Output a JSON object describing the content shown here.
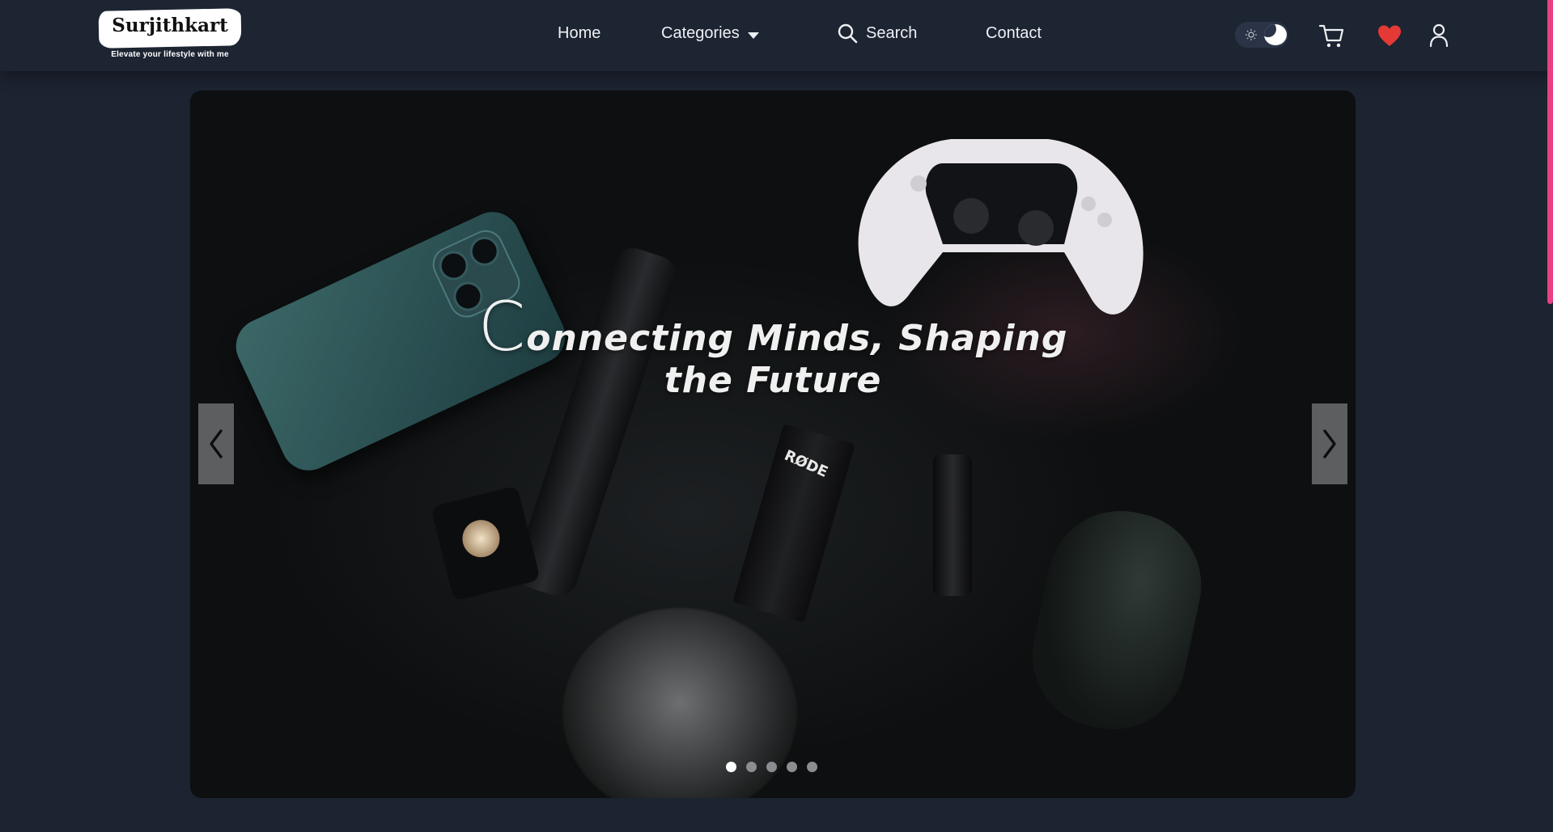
{
  "brand": {
    "name": "Surjithkart",
    "tagline": "Elevate your lifestyle with me"
  },
  "nav": {
    "home": "Home",
    "categories": "Categories",
    "search": "Search",
    "contact": "Contact"
  },
  "header_icons": [
    "theme-toggle-icon",
    "cart-icon",
    "heart-icon",
    "user-icon"
  ],
  "colors": {
    "background": "#1c2331",
    "accent": "#ea3f83",
    "heart": "#e53935"
  },
  "hero": {
    "title_first_letter": "C",
    "title_rest": "onnecting Minds, Shaping the Future",
    "slides_count": 5,
    "active_slide": 1,
    "product_label": "RØDE"
  }
}
